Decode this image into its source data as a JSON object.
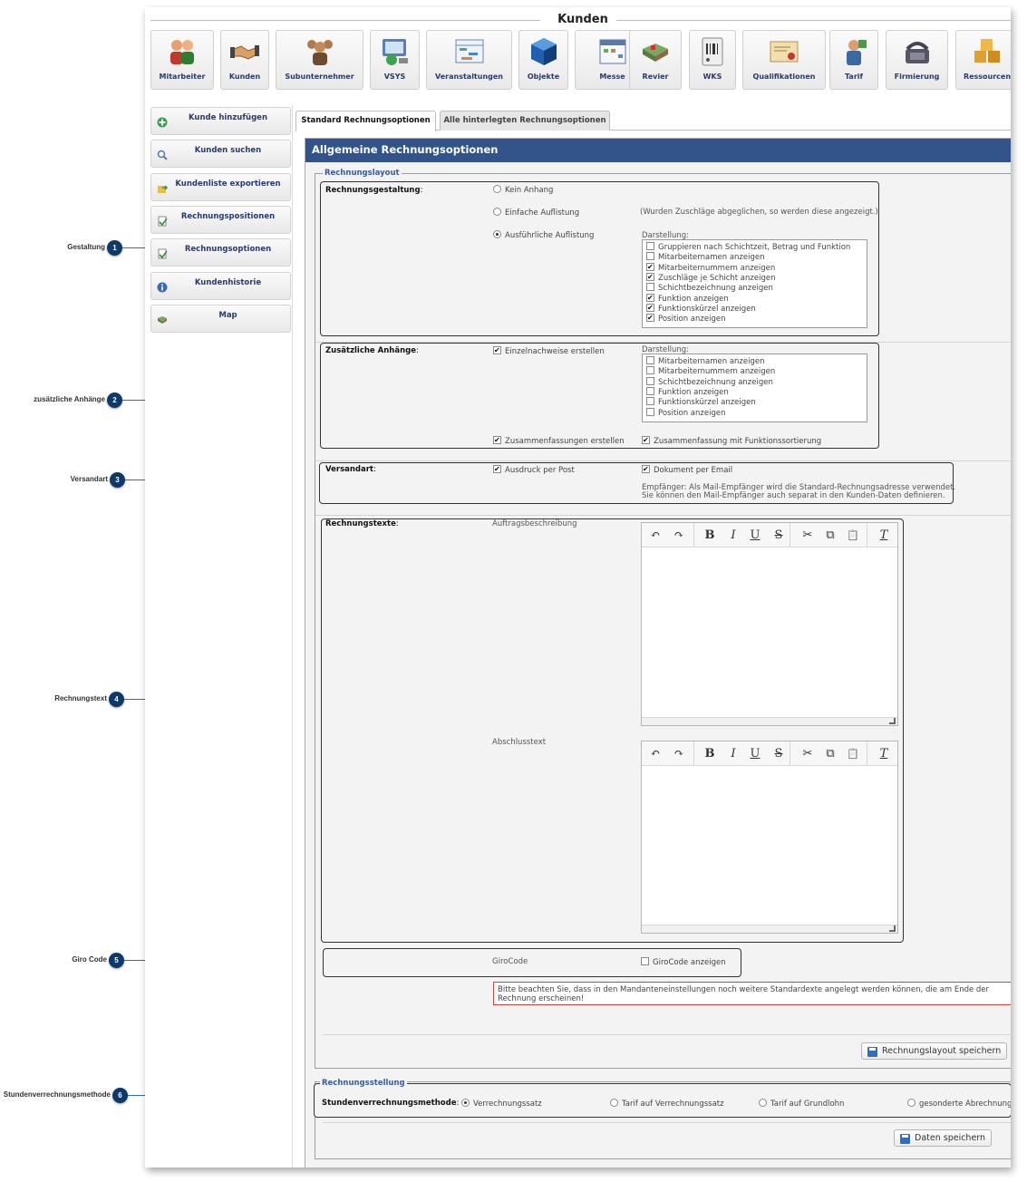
{
  "page_title": "Kunden",
  "toolbar": [
    {
      "label": "Mitarbeiter",
      "icon": "people-icon"
    },
    {
      "label": "Kunden",
      "icon": "handshake-icon"
    },
    {
      "label": "Subunternehmer",
      "icon": "group-icon"
    },
    {
      "label": "VSYS",
      "icon": "computer-icon"
    },
    {
      "label": "Veranstaltungen",
      "icon": "planner-icon"
    },
    {
      "label": "Objekte",
      "icon": "cube-icon"
    },
    {
      "label": "Messe",
      "icon": "calendar-icon"
    },
    {
      "label": "Revier",
      "icon": "map-icon"
    },
    {
      "label": "WKS",
      "icon": "barcode-icon"
    },
    {
      "label": "Qualifikationen",
      "icon": "certificate-icon"
    },
    {
      "label": "Tarif",
      "icon": "tariff-icon"
    },
    {
      "label": "Firmierung",
      "icon": "phone-icon"
    },
    {
      "label": "Ressourcen",
      "icon": "boxes-icon"
    }
  ],
  "sidenav": [
    {
      "label": "Kunde hinzufügen",
      "icon": "add-icon"
    },
    {
      "label": "Kunden suchen",
      "icon": "search-icon"
    },
    {
      "label": "Kundenliste exportieren",
      "icon": "export-icon"
    },
    {
      "label": "Rechnungspositionen",
      "icon": "invoice-icon"
    },
    {
      "label": "Rechnungsoptionen",
      "icon": "invoice-options-icon"
    },
    {
      "label": "Kundenhistorie",
      "icon": "info-icon"
    },
    {
      "label": "Map",
      "icon": "map-icon"
    }
  ],
  "tabs": [
    "Standard Rechnungsoptionen",
    "Alle hinterlegten Rechnungsoptionen"
  ],
  "panel_title": "Allgemeine Rechnungsoptionen",
  "callouts": [
    {
      "num": "1",
      "label": "Gestaltung"
    },
    {
      "num": "2",
      "label": "zusätzliche Anhänge"
    },
    {
      "num": "3",
      "label": "Versandart"
    },
    {
      "num": "4",
      "label": "Rechnungstext"
    },
    {
      "num": "5",
      "label": "Giro Code"
    },
    {
      "num": "6",
      "label": "Stundenverrechnungsmethode"
    }
  ],
  "layout_section": {
    "legend": "Rechnungslayout",
    "gestaltung": {
      "label": "Rechnungsgestaltung",
      "options": [
        {
          "label": "Kein Anhang",
          "selected": false
        },
        {
          "label": "Einfache Auflistung",
          "selected": false
        },
        {
          "label": "Ausführliche Auflistung",
          "selected": true
        }
      ],
      "hint": "(Wurden Zuschläge abgeglichen, so werden diese angezeigt.)",
      "darstellung_label": "Darstellung:",
      "darstellung": [
        {
          "label": "Gruppieren nach Schichtzeit, Betrag und Funktion",
          "checked": false
        },
        {
          "label": "Mitarbeiternamen anzeigen",
          "checked": false
        },
        {
          "label": "Mitarbeiternummern anzeigen",
          "checked": true
        },
        {
          "label": "Zuschläge je Schicht anzeigen",
          "checked": true
        },
        {
          "label": "Schichtbezeichnung anzeigen",
          "checked": false
        },
        {
          "label": "Funktion anzeigen",
          "checked": true
        },
        {
          "label": "Funktionskürzel anzeigen",
          "checked": true
        },
        {
          "label": "Position anzeigen",
          "checked": true
        }
      ]
    },
    "anhaenge": {
      "label": "Zusätzliche Anhänge",
      "einzelnachweise": {
        "label": "Einzelnachweise erstellen",
        "checked": true
      },
      "darstellung_label": "Darstellung:",
      "darstellung": [
        {
          "label": "Mitarbeiternamen anzeigen",
          "checked": false
        },
        {
          "label": "Mitarbeiternummern anzeigen",
          "checked": false
        },
        {
          "label": "Schichtbezeichnung anzeigen",
          "checked": false
        },
        {
          "label": "Funktion anzeigen",
          "checked": false
        },
        {
          "label": "Funktionskürzel anzeigen",
          "checked": false
        },
        {
          "label": "Position anzeigen",
          "checked": false
        }
      ],
      "zusammenfassungen": {
        "label": "Zusammenfassungen erstellen",
        "checked": true
      },
      "sortierung": {
        "label": "Zusammenfassung mit Funktionssortierung",
        "checked": true
      }
    },
    "versandart": {
      "label": "Versandart",
      "post": {
        "label": "Ausdruck per Post",
        "checked": true
      },
      "email": {
        "label": "Dokument per Email",
        "checked": true
      },
      "hint_line1": "Empfänger: Als Mail-Empfänger wird die Standard-Rechnungsadresse verwendet.",
      "hint_line2": "Sie können den Mail-Empfänger auch separat in den Kunden-Daten definieren."
    },
    "texte": {
      "label": "Rechnungstexte",
      "auftrag_label": "Auftragsbeschreibung",
      "abschluss_label": "Abschlusstext"
    },
    "giro": {
      "label": "GiroCode",
      "checkbox": {
        "label": "GiroCode anzeigen",
        "checked": false
      }
    },
    "notice": "Bitte beachten Sie, dass in den Mandanteneinstellungen noch weitere Standardexte angelegt werden können, die am Ende der Rechnung erscheinen!",
    "save_label": "Rechnungslayout speichern"
  },
  "stellung_section": {
    "legend": "Rechnungsstellung",
    "label": "Stundenverrechnungsmethode",
    "options": [
      {
        "label": "Verrechnungssatz",
        "selected": true
      },
      {
        "label": "Tarif auf Verrechnungssatz",
        "selected": false
      },
      {
        "label": "Tarif auf Grundlohn",
        "selected": false
      },
      {
        "label": "gesonderte Abrechnung",
        "selected": false
      }
    ],
    "save_label": "Daten speichern"
  },
  "editor_buttons": [
    "↶",
    "↷",
    "B",
    "I",
    "U",
    "S",
    "✂",
    "⧉",
    "📋",
    "T"
  ]
}
